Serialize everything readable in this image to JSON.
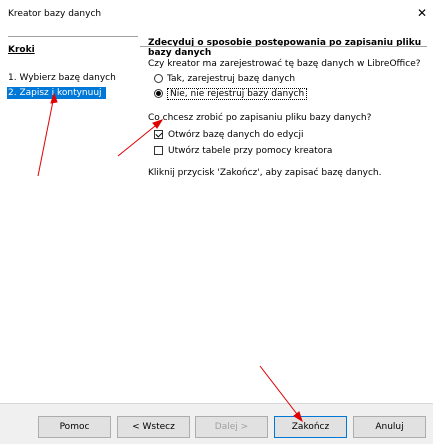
{
  "window": {
    "title": "Kreator bazy danych",
    "close_glyph": "✕"
  },
  "sidebar": {
    "title": "Kroki",
    "items": [
      {
        "label": "1. Wybierz bazę danych",
        "active": false
      },
      {
        "label": "2. Zapisz i kontynuuj",
        "active": true
      }
    ]
  },
  "main": {
    "title": "Zdecyduj o sposobie postępowania po zapisaniu pliku bazy danych",
    "question1": "Czy kreator ma zarejestrować tę bazę danych w LibreOffice?",
    "radio_yes": "Tak, zarejestruj bazę danych",
    "radio_no": "Nie, nie rejestruj bazy danych",
    "question2": "Co chcesz zrobić po zapisaniu pliku bazy danych?",
    "check_open": "Otwórz bazę danych do edycji",
    "check_tables": "Utwórz tabele przy pomocy kreatora",
    "hint": "Kliknij przycisk 'Zakończ', aby zapisać bazę danych."
  },
  "buttons": {
    "help": "Pomoc",
    "back": "< Wstecz",
    "next": "Dalej >",
    "finish": "Zakończ",
    "cancel": "Anuluj"
  },
  "colors": {
    "selection": "#0078d7",
    "annotation_arrow": "#e00000"
  }
}
